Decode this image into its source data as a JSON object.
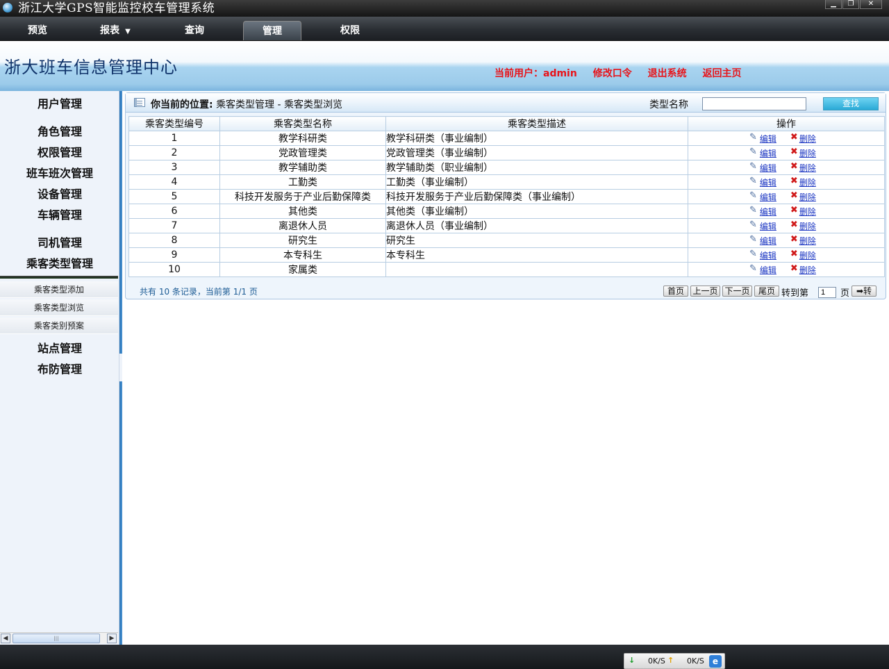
{
  "window": {
    "title": "浙江大学GPS智能监控校车管理系统",
    "controls": [
      "minimize",
      "restore",
      "close"
    ]
  },
  "menu": [
    {
      "label": "预览",
      "active": false
    },
    {
      "label": "报表",
      "active": false,
      "caret": "▼"
    },
    {
      "label": "查询",
      "active": false
    },
    {
      "label": "管理",
      "active": true
    },
    {
      "label": "权限",
      "active": false
    }
  ],
  "header": {
    "brand": "浙大班车信息管理中心",
    "current_user": "当前用户：admin",
    "change_password": "修改口令",
    "logout": "退出系统",
    "home": "返回主页"
  },
  "sidebar": {
    "items": [
      "用户管理",
      "角色管理",
      "权限管理",
      "班车班次管理",
      "设备管理",
      "车辆管理",
      "司机管理",
      "乘客类型管理"
    ],
    "sub_items": [
      "乘客类型添加",
      "乘客类型浏览",
      "乘客类别预案"
    ],
    "items_after": [
      "站点管理",
      "布防管理"
    ]
  },
  "breadcrumb": {
    "label": "你当前的位置:",
    "path": "乘客类型管理 - 乘客类型浏览"
  },
  "search": {
    "label": "类型名称",
    "value": "",
    "button": "查找"
  },
  "table": {
    "headers": [
      "乘客类型编号",
      "乘客类型名称",
      "乘客类型描述",
      "操作"
    ],
    "rows": [
      {
        "id": "1",
        "name": "教学科研类",
        "desc": "教学科研类（事业编制）"
      },
      {
        "id": "2",
        "name": "党政管理类",
        "desc": "党政管理类（事业编制）"
      },
      {
        "id": "3",
        "name": "教学辅助类",
        "desc": "教学辅助类（职业编制）"
      },
      {
        "id": "4",
        "name": "工勤类",
        "desc": "工勤类（事业编制）"
      },
      {
        "id": "5",
        "name": "科技开发服务于产业后勤保障类",
        "desc": "科技开发服务于产业后勤保障类（事业编制）"
      },
      {
        "id": "6",
        "name": "其他类",
        "desc": "其他类（事业编制）"
      },
      {
        "id": "7",
        "name": "离退休人员",
        "desc": "离退休人员（事业编制）"
      },
      {
        "id": "8",
        "name": "研究生",
        "desc": "研究生"
      },
      {
        "id": "9",
        "name": "本专科生",
        "desc": "本专科生"
      },
      {
        "id": "10",
        "name": "家属类",
        "desc": ""
      }
    ],
    "edit_label": "编辑",
    "delete_label": "删除"
  },
  "pagination": {
    "summary": "共有 10 条记录，当前第 1/1 页",
    "first": "首页",
    "prev": "上一页",
    "next": "下一页",
    "last": "尾页",
    "goto_label": "转到第",
    "page_value": "1",
    "page_suffix": "页",
    "go_button": "➡转"
  },
  "tray": {
    "down_rate": "0K/S",
    "up_rate": "0K/S"
  },
  "colors": {
    "header_links": "#e8141a",
    "brand": "#10336a",
    "action_links": "#1a35c2",
    "search_button": "#29a9d6"
  }
}
